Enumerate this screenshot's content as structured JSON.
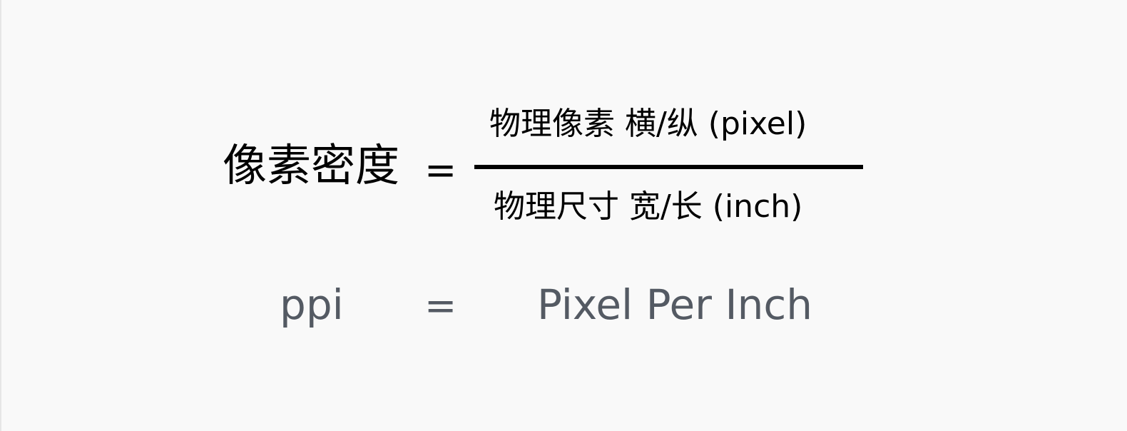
{
  "formula": {
    "lhs": "像素密度",
    "equals": "=",
    "numerator": "物理像素 横/纵 (pixel)",
    "denominator": "物理尺寸 宽/长 (inch)"
  },
  "abbreviation": {
    "term": "ppi",
    "equals": "=",
    "expansion": "Pixel Per Inch"
  },
  "colors": {
    "background": "#f9f9f9",
    "formula_text": "#000000",
    "abbreviation_text": "#545a63"
  }
}
